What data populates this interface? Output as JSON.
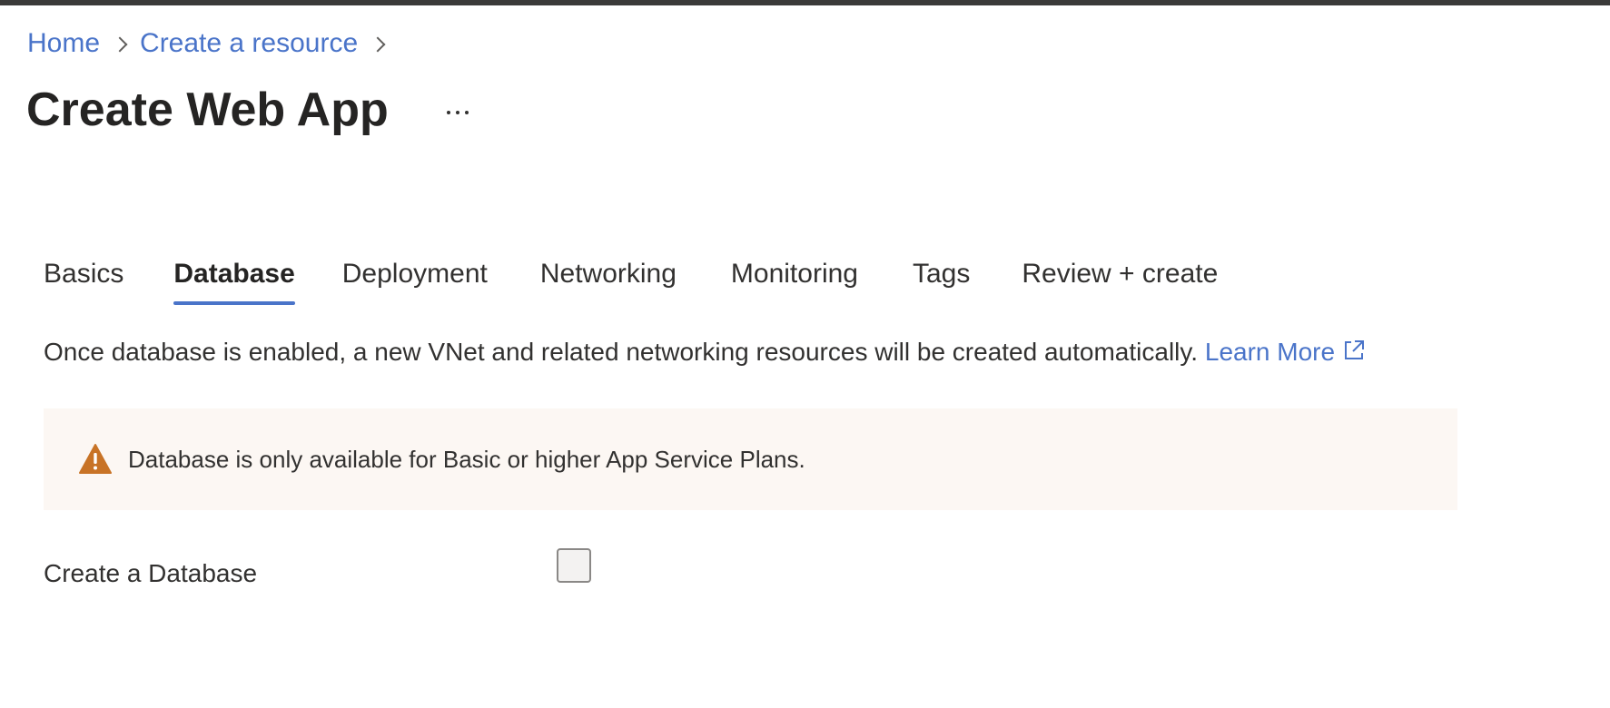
{
  "breadcrumb": {
    "items": [
      "Home",
      "Create a resource"
    ]
  },
  "page": {
    "title": "Create Web App"
  },
  "tabs": [
    {
      "label": "Basics",
      "active": false
    },
    {
      "label": "Database",
      "active": true
    },
    {
      "label": "Deployment",
      "active": false
    },
    {
      "label": "Networking",
      "active": false
    },
    {
      "label": "Monitoring",
      "active": false
    },
    {
      "label": "Tags",
      "active": false
    },
    {
      "label": "Review + create",
      "active": false
    }
  ],
  "info": {
    "text": "Once database is enabled, a new VNet and related networking resources will be created automatically.",
    "link_label": "Learn More"
  },
  "warning": {
    "text": "Database is only available for Basic or higher App Service Plans.",
    "icon": "warning-icon",
    "color": "#c87326"
  },
  "form": {
    "create_database_label": "Create a Database",
    "create_database_checked": false
  },
  "colors": {
    "link": "#4a74c9",
    "warning_bg": "#fcf7f3",
    "topbar": "#3b3a39"
  }
}
